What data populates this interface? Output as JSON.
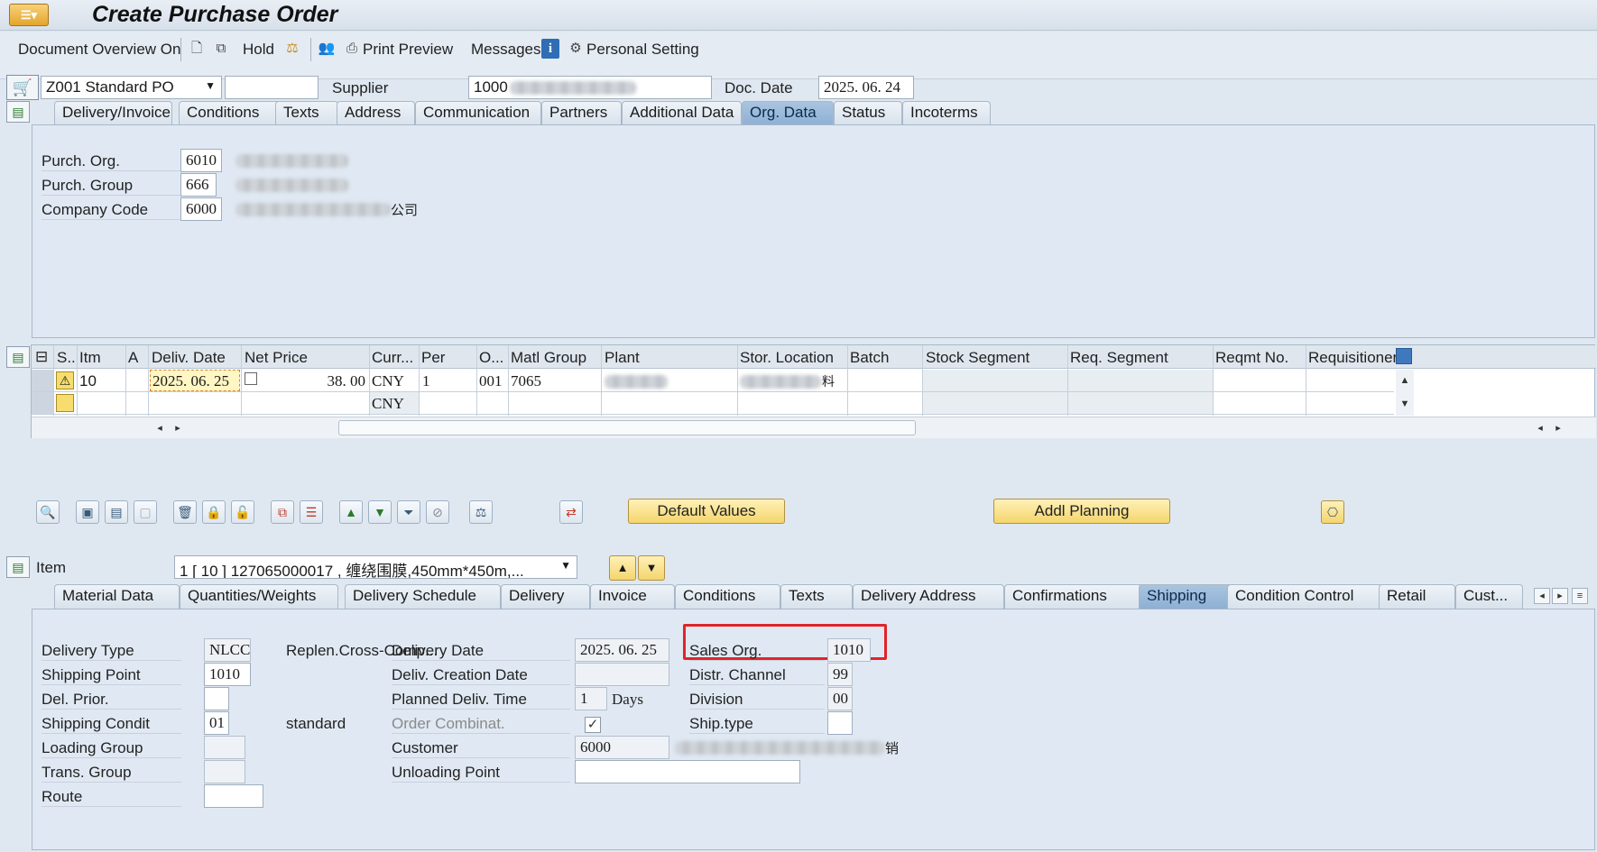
{
  "window": {
    "title": "Create Purchase Order"
  },
  "toolbar": {
    "doc_overview": "Document Overview On",
    "hold": "Hold",
    "print_preview": "Print Preview",
    "messages": "Messages",
    "personal_setting": "Personal Setting"
  },
  "header": {
    "doc_type": "Z001 Standard PO",
    "doc_type_extra": "",
    "supplier_label": "Supplier",
    "supplier_value": "1000",
    "doc_date_label": "Doc. Date",
    "doc_date_value": "2025. 06. 24",
    "tabs": [
      "Delivery/Invoice",
      "Conditions",
      "Texts",
      "Address",
      "Communication",
      "Partners",
      "Additional Data",
      "Org. Data",
      "Status",
      "Incoterms"
    ],
    "active_tab": "Org. Data",
    "org": {
      "purch_org_label": "Purch. Org.",
      "purch_org_value": "6010",
      "purch_group_label": "Purch. Group",
      "purch_group_value": "666",
      "company_code_label": "Company Code",
      "company_code_value": "6000",
      "company_code_suffix": "公司"
    }
  },
  "items": {
    "columns": [
      "S..",
      "Itm",
      "A",
      "Deliv. Date",
      "Net Price",
      "Curr...",
      "Per",
      "O...",
      "Matl Group",
      "Plant",
      "Stor. Location",
      "Batch",
      "Stock Segment",
      "Req. Segment",
      "Reqmt No.",
      "Requisitioner"
    ],
    "rows": [
      {
        "itm": "10",
        "deliv_date": "2025. 06. 25",
        "net_price": "38. 00",
        "curr": "CNY",
        "per": "1",
        "o": "001",
        "matl_group": "7065",
        "stor_suffix": "料"
      },
      {
        "curr": "CNY"
      }
    ],
    "buttons": {
      "default_values": "Default Values",
      "addl_planning": "Addl Planning"
    }
  },
  "item_detail": {
    "item_label": "Item",
    "item_select": "1 [ 10 ] 127065000017 , 缠绕围膜,450mm*450m,...",
    "tabs": [
      "Material Data",
      "Quantities/Weights",
      "Delivery Schedule",
      "Delivery",
      "Invoice",
      "Conditions",
      "Texts",
      "Delivery Address",
      "Confirmations",
      "Shipping",
      "Condition Control",
      "Retail",
      "Cust..."
    ],
    "active_tab": "Shipping",
    "shipping": {
      "delivery_type_label": "Delivery Type",
      "delivery_type_value": "NLCC",
      "replen_label": "Replen.Cross-Comp...",
      "shipping_point_label": "Shipping Point",
      "shipping_point_value": "1010",
      "del_prior_label": "Del. Prior.",
      "del_prior_value": "",
      "shipping_cond_label": "Shipping Condit",
      "shipping_cond_value": "01",
      "shipping_cond_text": "standard",
      "loading_group_label": "Loading Group",
      "loading_group_value": "",
      "trans_group_label": "Trans. Group",
      "trans_group_value": "",
      "route_label": "Route",
      "route_value": "",
      "delivery_date_label": "Delivery Date",
      "delivery_date_value": "2025. 06. 25",
      "deliv_creation_label": "Deliv. Creation Date",
      "deliv_creation_value": "",
      "planned_time_label": "Planned Deliv. Time",
      "planned_time_value": "1",
      "planned_time_unit": "Days",
      "order_combinat_label": "Order Combinat.",
      "order_combinat_checked": "✓",
      "customer_label": "Customer",
      "customer_value": "6000",
      "customer_suffix": "销",
      "unloading_label": "Unloading Point",
      "unloading_value": "",
      "sales_org_label": "Sales Org.",
      "sales_org_value": "1010",
      "distr_channel_label": "Distr. Channel",
      "distr_channel_value": "99",
      "division_label": "Division",
      "division_value": "00",
      "ship_type_label": "Ship.type",
      "ship_type_value": ""
    }
  }
}
